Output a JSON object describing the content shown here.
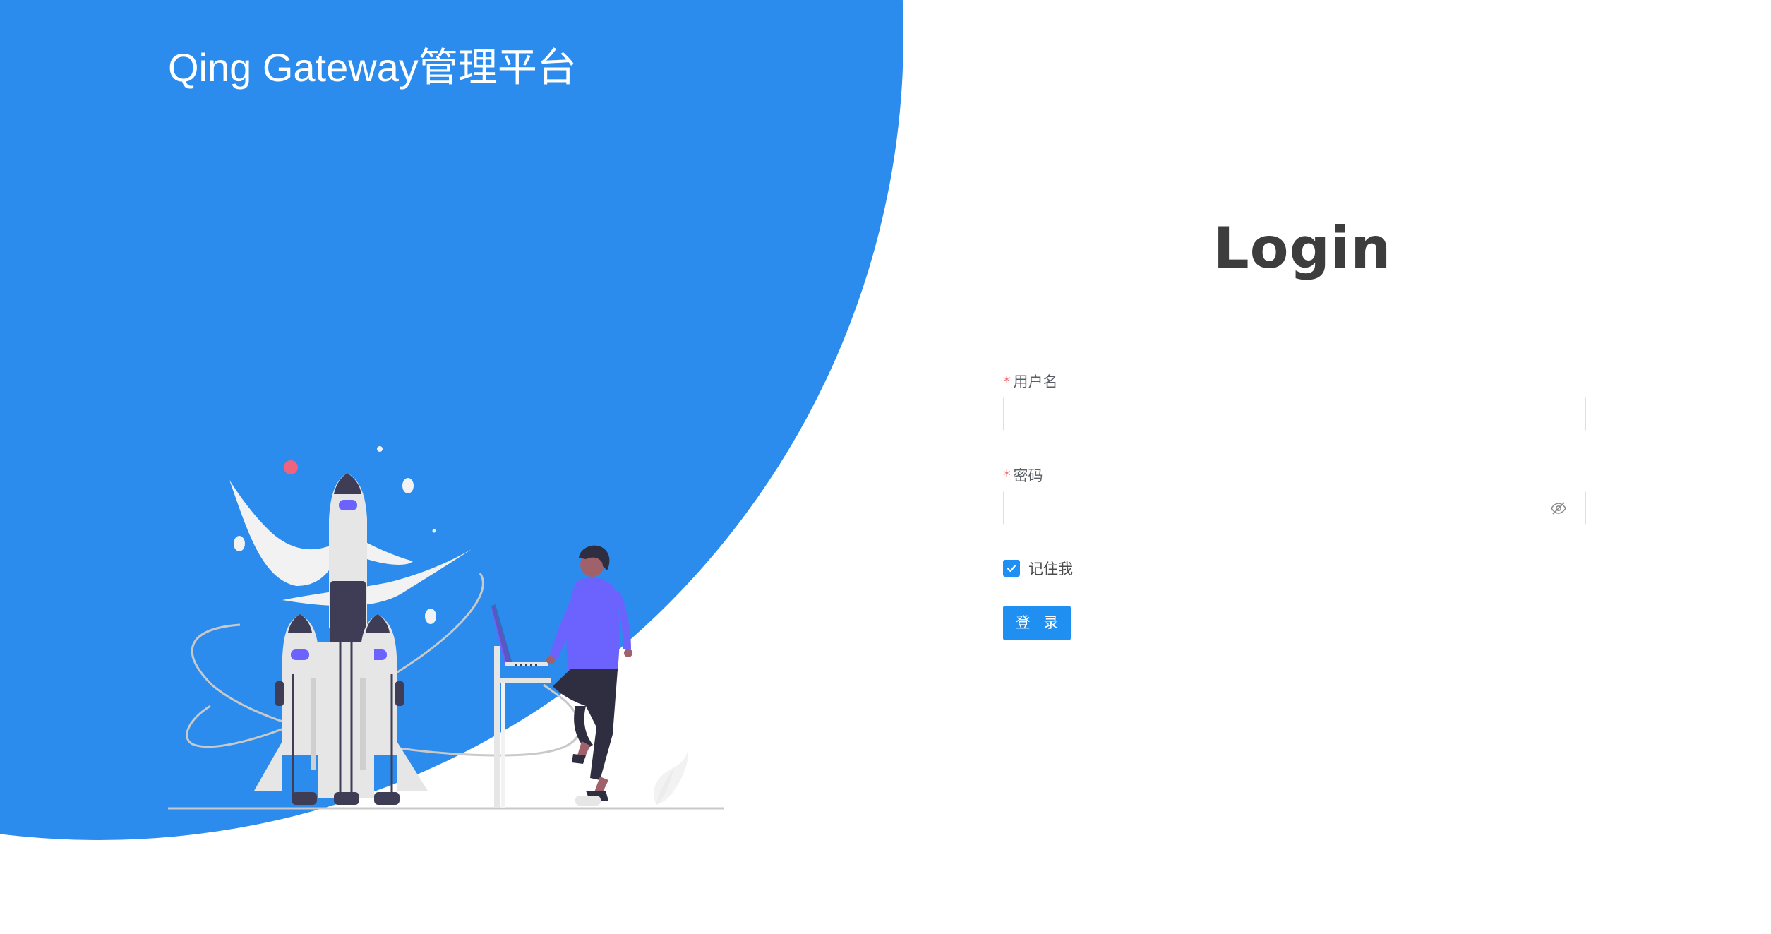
{
  "brand": {
    "title": "Qing Gateway管理平台"
  },
  "login": {
    "heading": "Login",
    "username": {
      "label": "用户名",
      "required_mark": "*",
      "value": ""
    },
    "password": {
      "label": "密码",
      "required_mark": "*",
      "value": "",
      "toggle_icon": "eye-hidden-icon"
    },
    "remember": {
      "label": "记住我",
      "checked": true
    },
    "submit_label": "登 录"
  },
  "colors": {
    "brand_blue": "#2b8ced",
    "primary": "#1f8ff2",
    "heading": "#3d3d3d",
    "required": "#f56c6c",
    "figure_purple": "#6c63ff",
    "figure_dark": "#3f3d56"
  }
}
